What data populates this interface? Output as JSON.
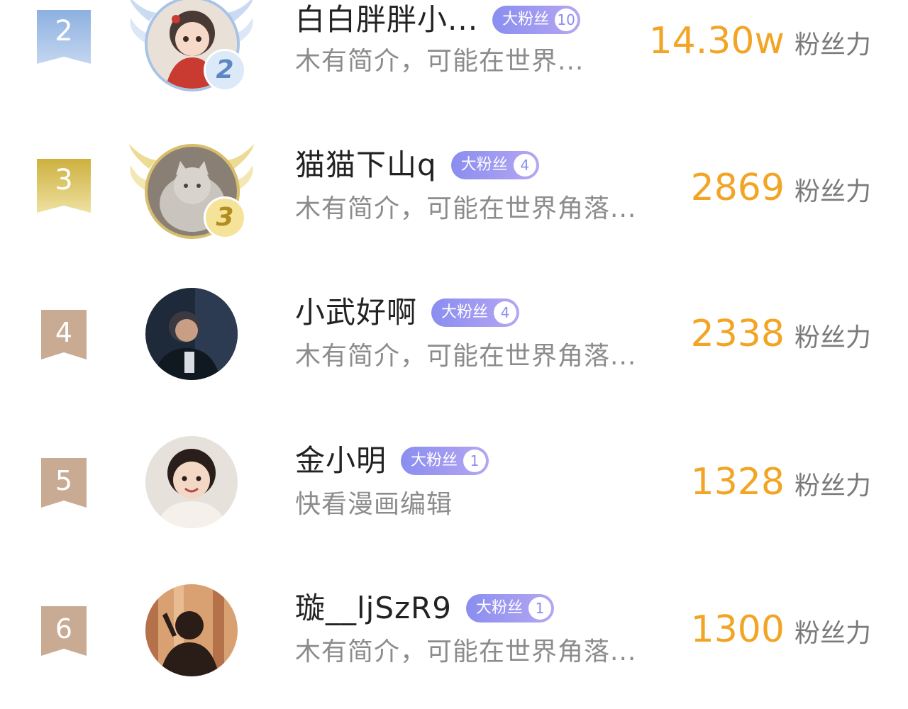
{
  "colors": {
    "score": "#f2a524",
    "rank_2": "#9fbde6",
    "rank_3": "#d9c15c",
    "rank_other": "#c9ab94",
    "fan_tag": "#8a8ef0"
  },
  "fan_tag_label": "大粉丝",
  "score_unit": "粉丝力",
  "rows": [
    {
      "rank": "2",
      "medal": "2",
      "name": "白白胖胖小...",
      "fan_level": "10",
      "bio": "木有简介，可能在世界...",
      "score": "14.30w"
    },
    {
      "rank": "3",
      "medal": "3",
      "name": "猫猫下山q",
      "fan_level": "4",
      "bio": "木有简介，可能在世界角落...",
      "score": "2869"
    },
    {
      "rank": "4",
      "name": "小武好啊",
      "fan_level": "4",
      "bio": "木有简介，可能在世界角落...",
      "score": "2338"
    },
    {
      "rank": "5",
      "name": "金小明",
      "fan_level": "1",
      "bio": "快看漫画编辑",
      "score": "1328"
    },
    {
      "rank": "6",
      "name": "璇__ljSzR9",
      "fan_level": "1",
      "bio": "木有简介，可能在世界角落...",
      "score": "1300"
    }
  ]
}
